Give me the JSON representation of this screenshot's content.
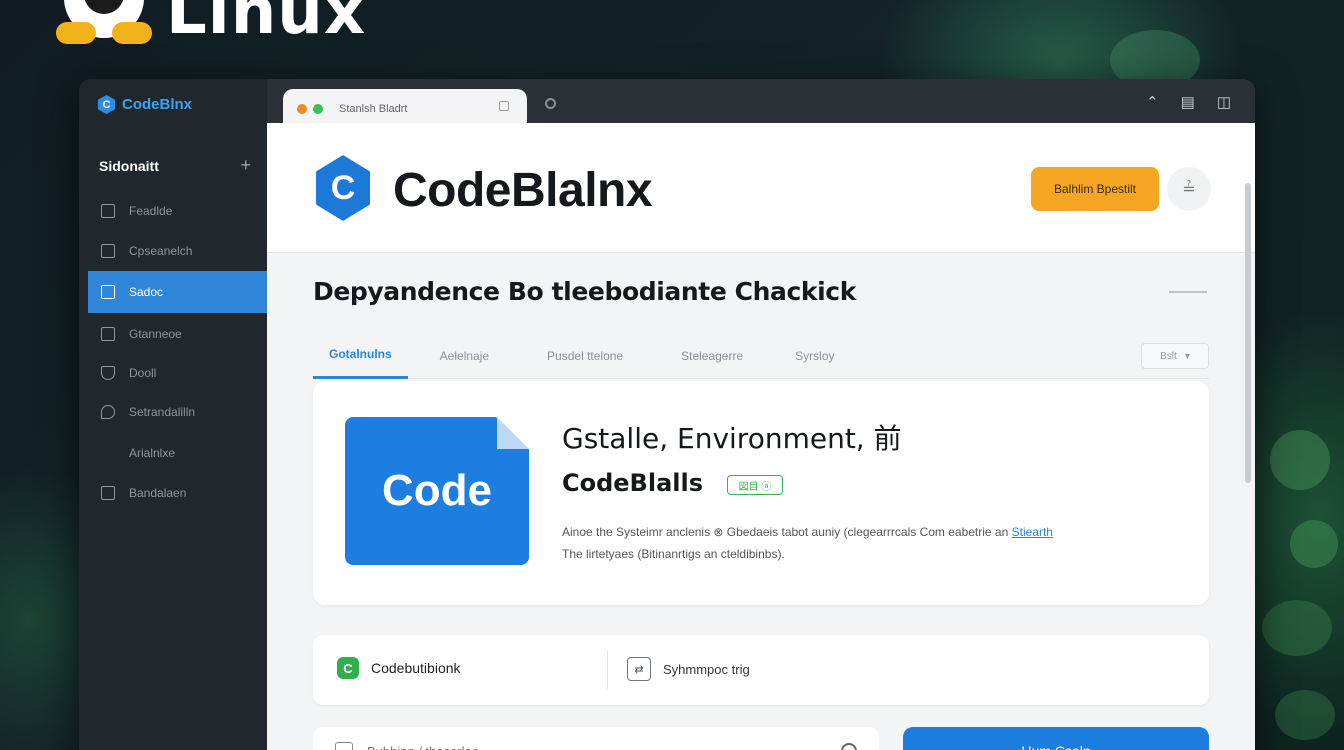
{
  "header": {
    "title": "Linux"
  },
  "sidebar": {
    "brand": "CodeBlnx",
    "section_title": "Sidonaitt",
    "items": [
      {
        "label": "Feadlde",
        "icon": "page-icon"
      },
      {
        "label": "Cpseanelch",
        "icon": "clipboard-icon"
      },
      {
        "label": "Sadoc",
        "icon": "terminal-icon",
        "active": true
      },
      {
        "label": "Gtanneoe",
        "icon": "edit-icon"
      },
      {
        "label": "Dooll",
        "icon": "shield-icon"
      },
      {
        "label": "Setrandalilln",
        "icon": "pin-icon"
      },
      {
        "label": "Arialnlxe",
        "icon": ""
      },
      {
        "label": "Bandalaen",
        "icon": "folder-icon"
      }
    ]
  },
  "browser": {
    "tab_title": "Stanlsh Bladrt",
    "icons": [
      "wifi-icon",
      "window-icon",
      "camera-icon"
    ]
  },
  "main": {
    "hero_title": "CodeBlalnx",
    "hero_button": "Balhlim Bpestilt",
    "heading": "Depyandence Bo tleebodiante Chackick",
    "tabs": [
      "Gotalnulns",
      "Aelelnaje",
      "Pusdel ttelone",
      "Steleagerre",
      "Syrsloy"
    ],
    "filter_select": "Bslt",
    "card": {
      "icon_label": "Code",
      "title": "Gstalle, Environment, 前",
      "subtitle": "CodeBlalls",
      "badge": "図目 ⓐ",
      "desc_line1": "Ainoe the Systeimr anclenis  ⊗ Gbedaeis tabot auniy (clegearrrcals Com eabetrie an",
      "desc_link": "Stiearth",
      "desc_line2": "The lirtetyaes (Bitinanrtigs an cteldibinbs)."
    },
    "panel": {
      "left_label": "Codebutibionk",
      "left_icon": "C",
      "right_label": "Syhmmpoc trig",
      "right_icon": "⇄"
    },
    "search": {
      "placeholder": "Bubhinn / thaserlae"
    },
    "cta": "Hum Csaln"
  }
}
